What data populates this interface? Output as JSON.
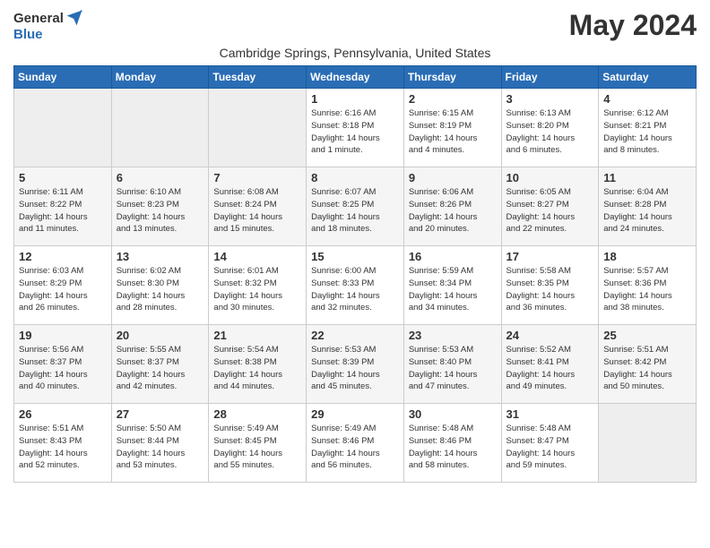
{
  "header": {
    "logo_general": "General",
    "logo_blue": "Blue",
    "month_title": "May 2024",
    "subtitle": "Cambridge Springs, Pennsylvania, United States"
  },
  "days_of_week": [
    "Sunday",
    "Monday",
    "Tuesday",
    "Wednesday",
    "Thursday",
    "Friday",
    "Saturday"
  ],
  "weeks": [
    [
      {
        "day": "",
        "info": ""
      },
      {
        "day": "",
        "info": ""
      },
      {
        "day": "",
        "info": ""
      },
      {
        "day": "1",
        "info": "Sunrise: 6:16 AM\nSunset: 8:18 PM\nDaylight: 14 hours\nand 1 minute."
      },
      {
        "day": "2",
        "info": "Sunrise: 6:15 AM\nSunset: 8:19 PM\nDaylight: 14 hours\nand 4 minutes."
      },
      {
        "day": "3",
        "info": "Sunrise: 6:13 AM\nSunset: 8:20 PM\nDaylight: 14 hours\nand 6 minutes."
      },
      {
        "day": "4",
        "info": "Sunrise: 6:12 AM\nSunset: 8:21 PM\nDaylight: 14 hours\nand 8 minutes."
      }
    ],
    [
      {
        "day": "5",
        "info": "Sunrise: 6:11 AM\nSunset: 8:22 PM\nDaylight: 14 hours\nand 11 minutes."
      },
      {
        "day": "6",
        "info": "Sunrise: 6:10 AM\nSunset: 8:23 PM\nDaylight: 14 hours\nand 13 minutes."
      },
      {
        "day": "7",
        "info": "Sunrise: 6:08 AM\nSunset: 8:24 PM\nDaylight: 14 hours\nand 15 minutes."
      },
      {
        "day": "8",
        "info": "Sunrise: 6:07 AM\nSunset: 8:25 PM\nDaylight: 14 hours\nand 18 minutes."
      },
      {
        "day": "9",
        "info": "Sunrise: 6:06 AM\nSunset: 8:26 PM\nDaylight: 14 hours\nand 20 minutes."
      },
      {
        "day": "10",
        "info": "Sunrise: 6:05 AM\nSunset: 8:27 PM\nDaylight: 14 hours\nand 22 minutes."
      },
      {
        "day": "11",
        "info": "Sunrise: 6:04 AM\nSunset: 8:28 PM\nDaylight: 14 hours\nand 24 minutes."
      }
    ],
    [
      {
        "day": "12",
        "info": "Sunrise: 6:03 AM\nSunset: 8:29 PM\nDaylight: 14 hours\nand 26 minutes."
      },
      {
        "day": "13",
        "info": "Sunrise: 6:02 AM\nSunset: 8:30 PM\nDaylight: 14 hours\nand 28 minutes."
      },
      {
        "day": "14",
        "info": "Sunrise: 6:01 AM\nSunset: 8:32 PM\nDaylight: 14 hours\nand 30 minutes."
      },
      {
        "day": "15",
        "info": "Sunrise: 6:00 AM\nSunset: 8:33 PM\nDaylight: 14 hours\nand 32 minutes."
      },
      {
        "day": "16",
        "info": "Sunrise: 5:59 AM\nSunset: 8:34 PM\nDaylight: 14 hours\nand 34 minutes."
      },
      {
        "day": "17",
        "info": "Sunrise: 5:58 AM\nSunset: 8:35 PM\nDaylight: 14 hours\nand 36 minutes."
      },
      {
        "day": "18",
        "info": "Sunrise: 5:57 AM\nSunset: 8:36 PM\nDaylight: 14 hours\nand 38 minutes."
      }
    ],
    [
      {
        "day": "19",
        "info": "Sunrise: 5:56 AM\nSunset: 8:37 PM\nDaylight: 14 hours\nand 40 minutes."
      },
      {
        "day": "20",
        "info": "Sunrise: 5:55 AM\nSunset: 8:37 PM\nDaylight: 14 hours\nand 42 minutes."
      },
      {
        "day": "21",
        "info": "Sunrise: 5:54 AM\nSunset: 8:38 PM\nDaylight: 14 hours\nand 44 minutes."
      },
      {
        "day": "22",
        "info": "Sunrise: 5:53 AM\nSunset: 8:39 PM\nDaylight: 14 hours\nand 45 minutes."
      },
      {
        "day": "23",
        "info": "Sunrise: 5:53 AM\nSunset: 8:40 PM\nDaylight: 14 hours\nand 47 minutes."
      },
      {
        "day": "24",
        "info": "Sunrise: 5:52 AM\nSunset: 8:41 PM\nDaylight: 14 hours\nand 49 minutes."
      },
      {
        "day": "25",
        "info": "Sunrise: 5:51 AM\nSunset: 8:42 PM\nDaylight: 14 hours\nand 50 minutes."
      }
    ],
    [
      {
        "day": "26",
        "info": "Sunrise: 5:51 AM\nSunset: 8:43 PM\nDaylight: 14 hours\nand 52 minutes."
      },
      {
        "day": "27",
        "info": "Sunrise: 5:50 AM\nSunset: 8:44 PM\nDaylight: 14 hours\nand 53 minutes."
      },
      {
        "day": "28",
        "info": "Sunrise: 5:49 AM\nSunset: 8:45 PM\nDaylight: 14 hours\nand 55 minutes."
      },
      {
        "day": "29",
        "info": "Sunrise: 5:49 AM\nSunset: 8:46 PM\nDaylight: 14 hours\nand 56 minutes."
      },
      {
        "day": "30",
        "info": "Sunrise: 5:48 AM\nSunset: 8:46 PM\nDaylight: 14 hours\nand 58 minutes."
      },
      {
        "day": "31",
        "info": "Sunrise: 5:48 AM\nSunset: 8:47 PM\nDaylight: 14 hours\nand 59 minutes."
      },
      {
        "day": "",
        "info": ""
      }
    ]
  ]
}
